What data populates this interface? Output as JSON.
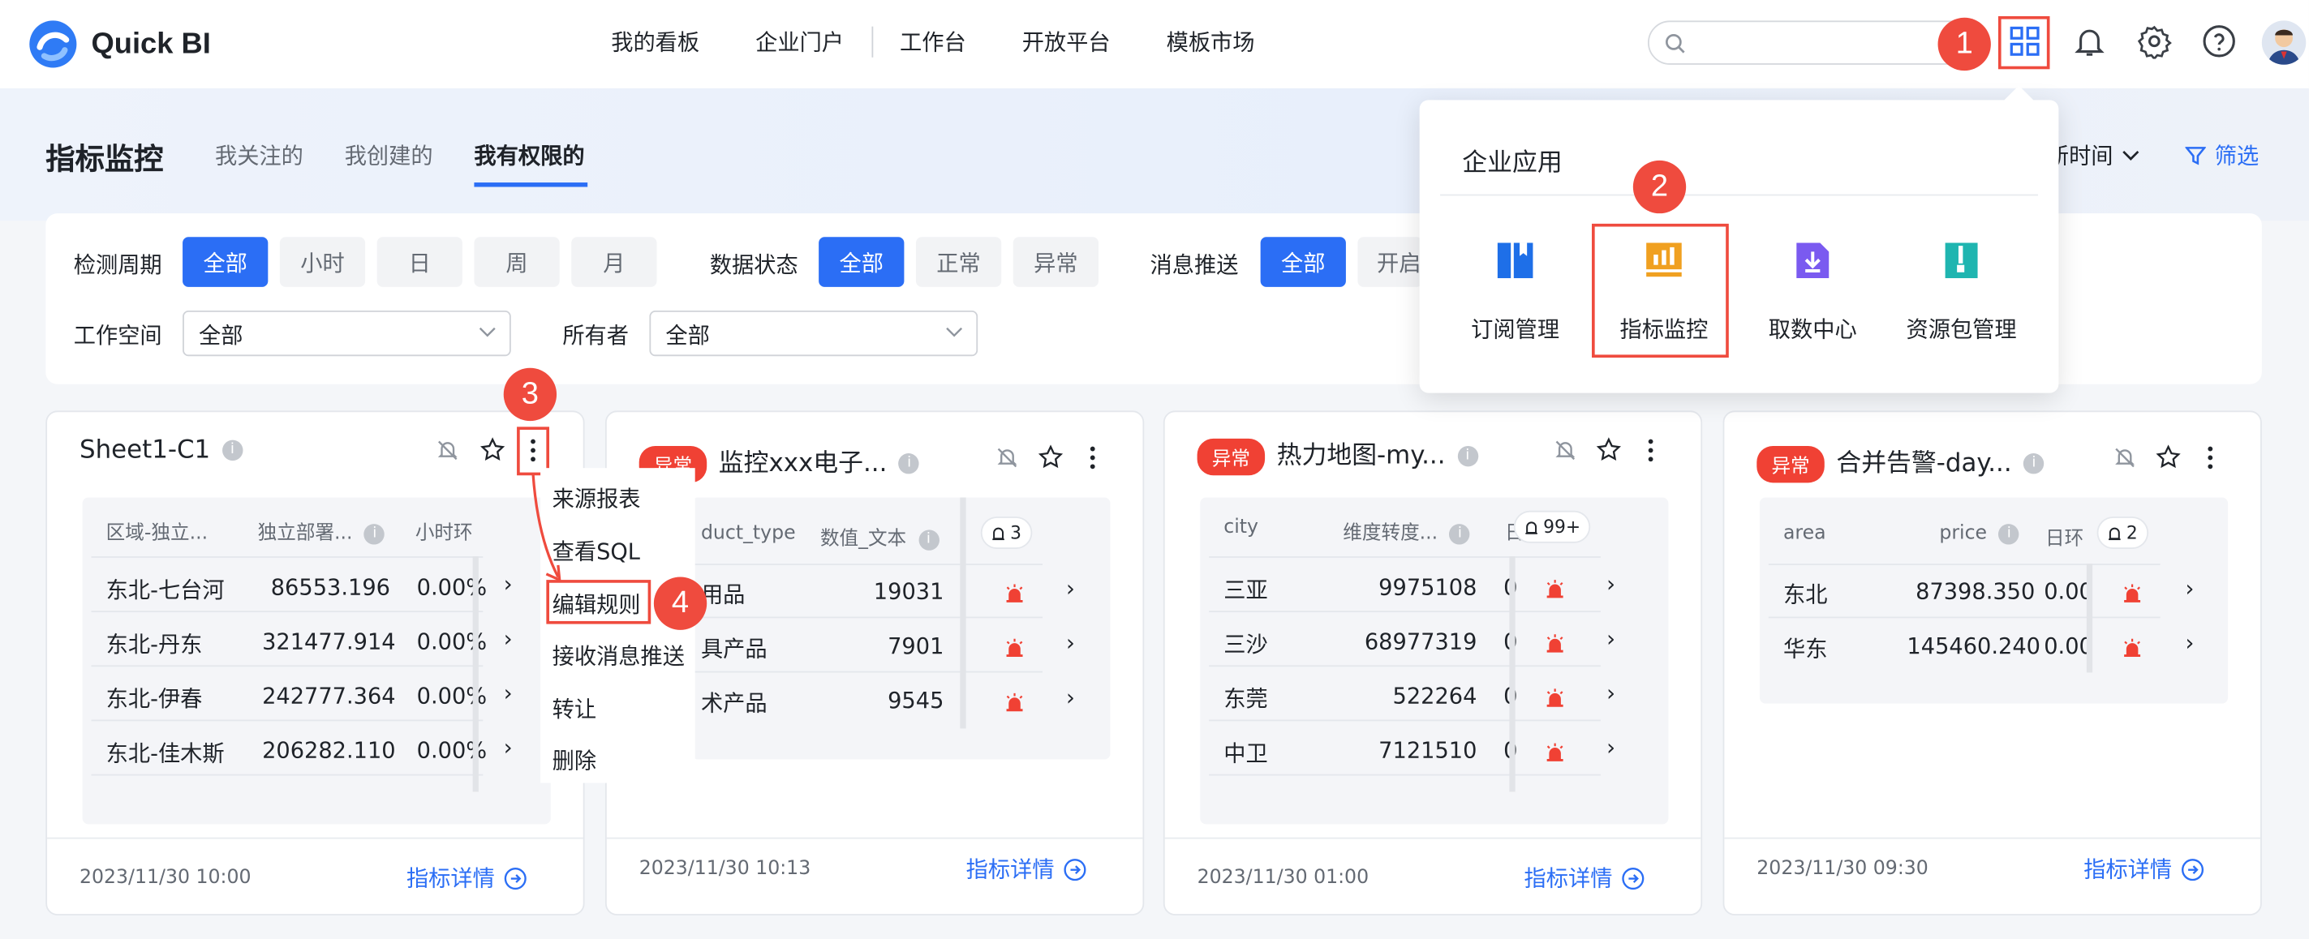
{
  "header": {
    "logo_text": "Quick BI",
    "nav": [
      "我的看板",
      "企业门户",
      "工作台",
      "开放平台",
      "模板市场"
    ],
    "search_placeholder": ""
  },
  "page": {
    "title": "指标监控",
    "tabs": [
      "我关注的",
      "我创建的",
      "我有权限的"
    ],
    "active_tab": "我有权限的",
    "sort_label": "新时间",
    "filter_label": "筛选"
  },
  "filters": {
    "period_label": "检测周期",
    "period_options": [
      "全部",
      "小时",
      "日",
      "周",
      "月"
    ],
    "status_label": "数据状态",
    "status_options": [
      "全部",
      "正常",
      "异常"
    ],
    "push_label": "消息推送",
    "push_options": [
      "全部",
      "开启"
    ],
    "workspace_label": "工作空间",
    "workspace_value": "全部",
    "owner_label": "所有者",
    "owner_value": "全部"
  },
  "popup": {
    "title": "企业应用",
    "apps": [
      {
        "label": "订阅管理",
        "icon": "book-icon",
        "color": "#1e6fe8"
      },
      {
        "label": "指标监控",
        "icon": "chart-monitor-icon",
        "color": "#f0a020"
      },
      {
        "label": "取数中心",
        "icon": "download-icon",
        "color": "#7a5af0"
      },
      {
        "label": "资源包管理",
        "icon": "zip-icon",
        "color": "#1fb5b0"
      }
    ]
  },
  "context_menu": [
    "来源报表",
    "查看SQL",
    "编辑规则",
    "接收消息推送",
    "转让",
    "删除"
  ],
  "steps": [
    "1",
    "2",
    "3",
    "4"
  ],
  "cards": [
    {
      "title": "Sheet1-C1",
      "abnormal": false,
      "headers": [
        "区域-独立...",
        "独立部署...",
        "小时环"
      ],
      "rows": [
        [
          "东北-七台河",
          "86553.196",
          "0.00%"
        ],
        [
          "东北-丹东",
          "321477.914",
          "0.00%"
        ],
        [
          "东北-伊春",
          "242777.364",
          "0.00%"
        ],
        [
          "东北-佳木斯",
          "206282.110",
          "0.00%"
        ]
      ],
      "footer_time": "2023/11/30 10:00",
      "detail_label": "指标详情"
    },
    {
      "title": "监控xxx电子...",
      "abnormal": true,
      "tag": "异常",
      "headers": [
        "duct_type",
        "数值_文本"
      ],
      "count": "3",
      "rows": [
        [
          "用品",
          "19031"
        ],
        [
          "具产品",
          "7901"
        ],
        [
          "术产品",
          "9545"
        ]
      ],
      "footer_time": "2023/11/30 10:13",
      "detail_label": "指标详情"
    },
    {
      "title": "热力地图-my...",
      "abnormal": true,
      "tag": "异常",
      "headers": [
        "city",
        "维度转度...",
        "日"
      ],
      "count": "99+",
      "rows": [
        [
          "三亚",
          "9975108",
          "0"
        ],
        [
          "三沙",
          "68977319",
          "0"
        ],
        [
          "东莞",
          "522264",
          "0"
        ],
        [
          "中卫",
          "7121510",
          "0"
        ]
      ],
      "footer_time": "2023/11/30 01:00",
      "detail_label": "指标详情"
    },
    {
      "title": "合并告警-day...",
      "abnormal": true,
      "tag": "异常",
      "headers": [
        "area",
        "price",
        "日环"
      ],
      "count": "2",
      "rows": [
        [
          "东北",
          "87398.350",
          "0.00"
        ],
        [
          "华东",
          "145460.240",
          "0.00"
        ]
      ],
      "footer_time": "2023/11/30 09:30",
      "detail_label": "指标详情"
    }
  ]
}
